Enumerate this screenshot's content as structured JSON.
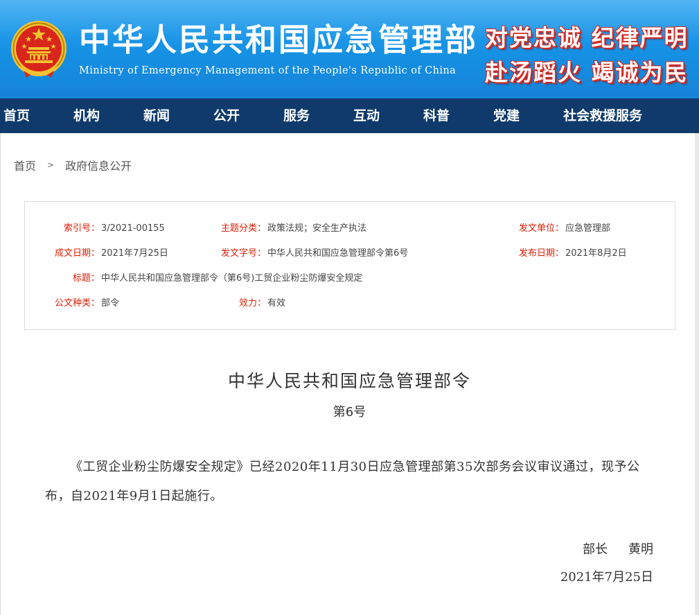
{
  "header": {
    "title": "中华人民共和国应急管理部",
    "subtitle": "Ministry of Emergency Management of the People's Republic of China",
    "slogan_line1": "对党忠诚 纪律严明",
    "slogan_line2": "赴汤蹈火 竭诚为民",
    "colors": {
      "banner": "#1a93e6",
      "nav": "#0f3a6b",
      "slogan_outline": "#d8271f",
      "label_red": "#d81e06"
    }
  },
  "nav": {
    "items": [
      "首页",
      "机构",
      "新闻",
      "公开",
      "服务",
      "互动",
      "科普",
      "党建",
      "社会救援服务"
    ]
  },
  "breadcrumb": {
    "home": "首页",
    "separator": ">",
    "current": "政府信息公开"
  },
  "info": {
    "index_label": "索引号：",
    "index_value": "3/2021-00155",
    "category_label": "主题分类：",
    "category_value": "政策法规；安全生产执法",
    "issuer_label": "发文单位：",
    "issuer_value": "应急管理部",
    "created_label": "成文日期：",
    "created_value": "2021年7月25日",
    "docno_label": "发文字号：",
    "docno_value": "中华人民共和国应急管理部令第6号",
    "published_label": "发布日期：",
    "published_value": "2021年8月2日",
    "title_label": "标题：",
    "title_value": "中华人民共和国应急管理部令（第6号)工贸企业粉尘防爆安全规定",
    "type_label": "公文种类：",
    "type_value": "部令",
    "validity_label": "效力：",
    "validity_value": "有效"
  },
  "article": {
    "title": "中华人民共和国应急管理部令",
    "number": "第6号",
    "body": "《工贸企业粉尘防爆安全规定》已经2020年11月30日应急管理部第35次部务会议审议通过，现予公布，自2021年9月1日起施行。",
    "signer_role": "部长",
    "signer_name": "黄明",
    "sign_date": "2021年7月25日"
  }
}
